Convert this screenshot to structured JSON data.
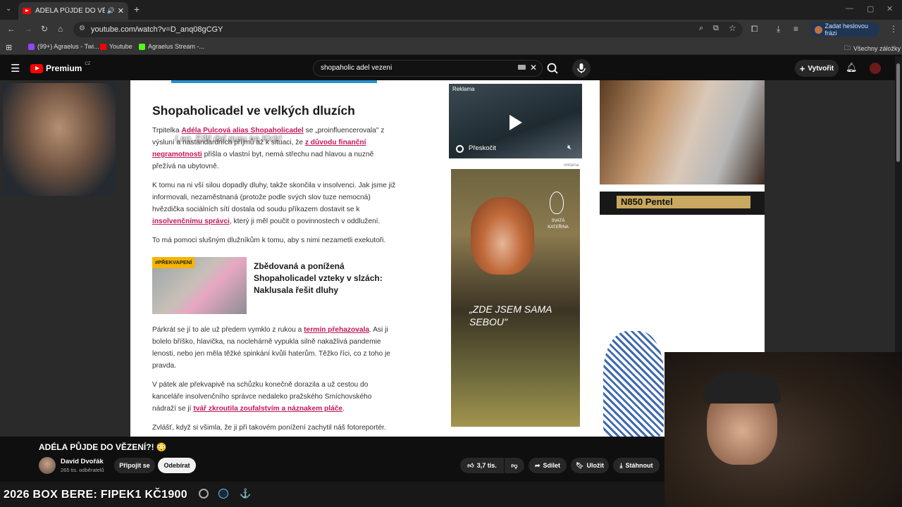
{
  "browser": {
    "tab_title": "ADÉLA PŮJDE DO VĚZENÍ?!",
    "url": "youtube.com/watch?v=D_anq08gCGY",
    "profile_chip": "Zadat heslovou frázi",
    "bookmarks": [
      {
        "label": "(99+) Agraelus - Twi...",
        "color": "#9146ff"
      },
      {
        "label": "Youtube",
        "color": "#ff0000"
      },
      {
        "label": "Agraelus Stream -...",
        "color": "#53fc18"
      }
    ],
    "all_bookmarks": "Všechny záložky"
  },
  "youtube": {
    "logo_text": "Premium",
    "logo_region": "CZ",
    "search_query": "shopaholic adel vezeni",
    "create_label": "Vytvořit"
  },
  "article": {
    "overlay": "Leo, Eiftl dal guru na Kick!",
    "title": "Shopaholicadel ve velkých dluzích",
    "p1_a": "Trpitelka ",
    "p1_link1": "Adéla Pulcová alias Shopaholicadel",
    "p1_b": " se „proinfluencerovala\" z výsluní a nastandardních příjmů až k situaci, že ",
    "p1_link2": "z důvodu finanční negramotnosti",
    "p1_c": " přišla o vlastní byt, nemá střechu nad hlavou a nuzně přežívá na ubytovně.",
    "p2_a": "K tomu na ni vší silou dopadly dluhy, takže skončila v insolvenci. Jak jsme již informovali, nezaměstnaná (protože podle svých slov tuze nemocná) hvězdička sociálních sítí dostala od soudu příkazem dostavit se k ",
    "p2_link": "insolvenčnímu správci",
    "p2_b": ", který ji měl poučit o povinnostech v oddlužení.",
    "p3": "To má pomoci slušným dlužníkům k tomu, aby s nimi nezametli exekutoři.",
    "related_tag": "#PŘEKVAPENÍ",
    "related_title": "Zbědovaná a ponížená Shopaholicadel vzteky v slzách: Naklusala řešit dluhy",
    "p4_a": "Párkrát se jí to ale už předem vymklo z rukou a ",
    "p4_link": "termín přehazovala",
    "p4_b": ". Asi ji bolelo bříško, hlavička, na noclehárně vypukla silně nakažlivá pandemie lenosti, nebo jen měla těžké spinkání kvůli haterům. Těžko říci, co z toho je pravda.",
    "p5_a": "V pátek ale překvapivě na schůzku konečně dorazila a už cestou do kanceláře insolvenčního správce nedaleko pražského Smíchovského nádraží se jí ",
    "p5_link": "tvář zkroutila zoufalstvím a náznakem pláče",
    "p5_b": ".",
    "p6": "Zvlášť, když si všimla, že ji při takovém ponížení zachytil náš fotoreportér."
  },
  "ads": {
    "ad1_tag": "Reklama",
    "ad1_skip": "Přeskočit",
    "ad2_label": "reklama",
    "ad2_quote": "„ZDE JSEM SAMA SEBOU\"",
    "ad2_brand": "SVATÁ KATEŘINA"
  },
  "pentel_label": "N850 Pentel",
  "video": {
    "title": "ADÉLA PŮJDE DO VĚZENÍ?! 😳",
    "channel": "David Dvořák",
    "subscribers": "265 tis. odběratelů",
    "join_label": "Připojit se",
    "subscribe_label": "Odebírat",
    "likes": "3,7 tis.",
    "share_label": "Sdílet",
    "save_label": "Uložit",
    "download_label": "Stáhnout"
  },
  "stream_overlay": "2026 BOX BERE: FIPEK1 KČ1900"
}
